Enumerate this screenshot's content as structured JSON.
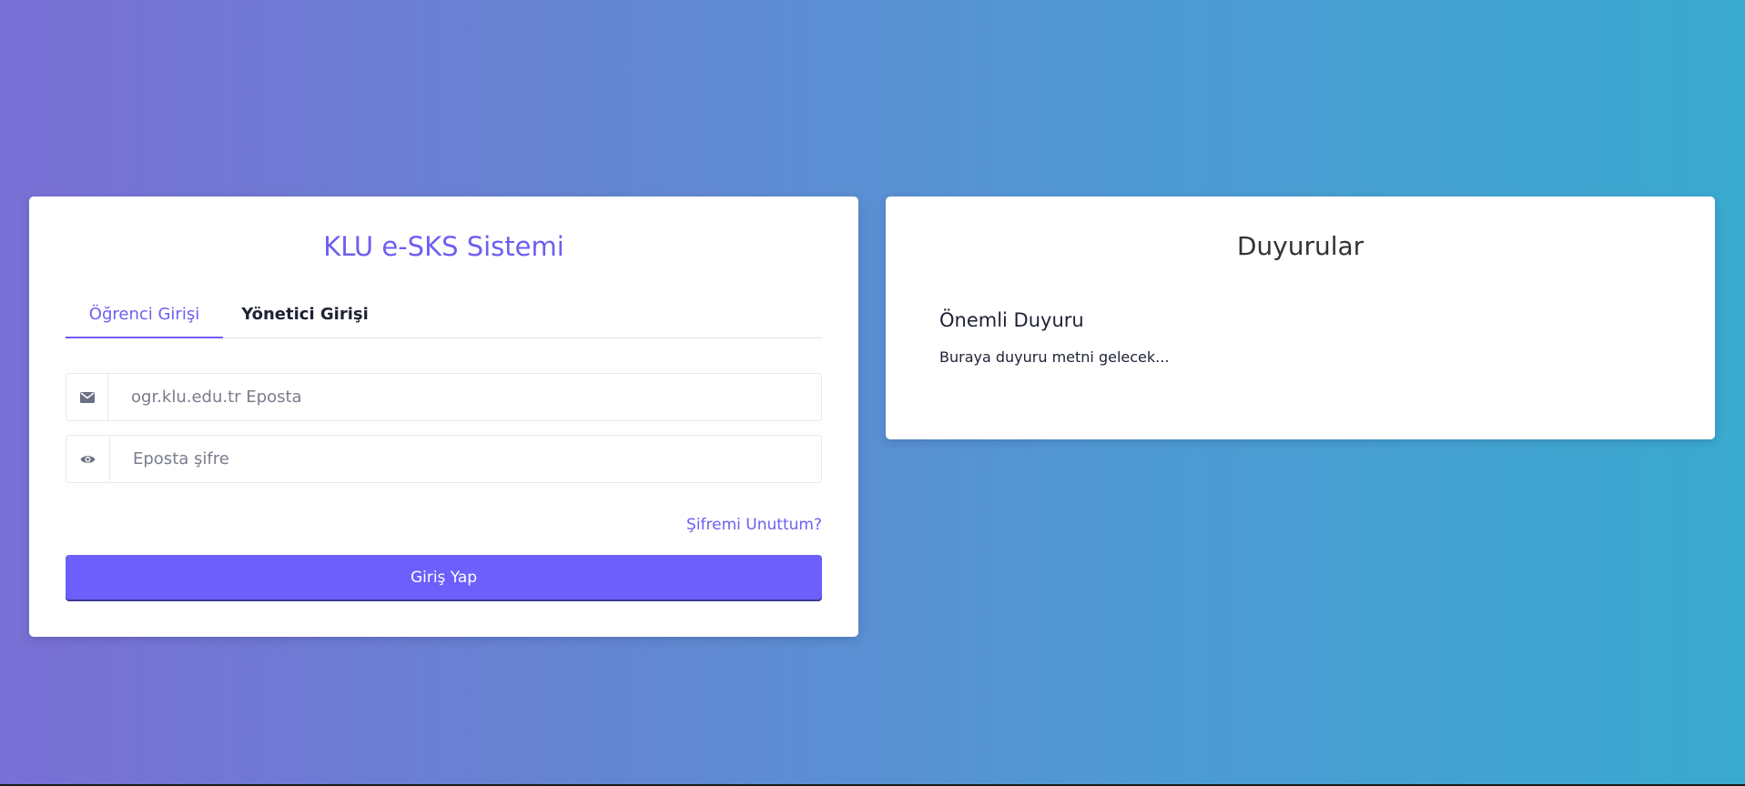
{
  "login": {
    "title": "KLU e-SKS Sistemi",
    "tabs": [
      {
        "label": "Öğrenci Girişi",
        "active": true
      },
      {
        "label": "Yönetici Girişi",
        "active": false
      }
    ],
    "email": {
      "placeholder": "ogr.klu.edu.tr Eposta",
      "value": "",
      "icon": "envelope-icon"
    },
    "password": {
      "placeholder": "Eposta şifre",
      "value": "",
      "icon": "eye-icon"
    },
    "forgot_label": "Şifremi Unuttum?",
    "submit_label": "Giriş Yap"
  },
  "announcements": {
    "title": "Duyurular",
    "items": [
      {
        "title": "Önemli Duyuru",
        "text": "Buraya duyuru metni gelecek..."
      }
    ]
  },
  "colors": {
    "accent": "#6e5ef0",
    "button": "#6c5ffc",
    "gradient_start": "#7a6fd5",
    "gradient_end": "#3aaad0"
  }
}
